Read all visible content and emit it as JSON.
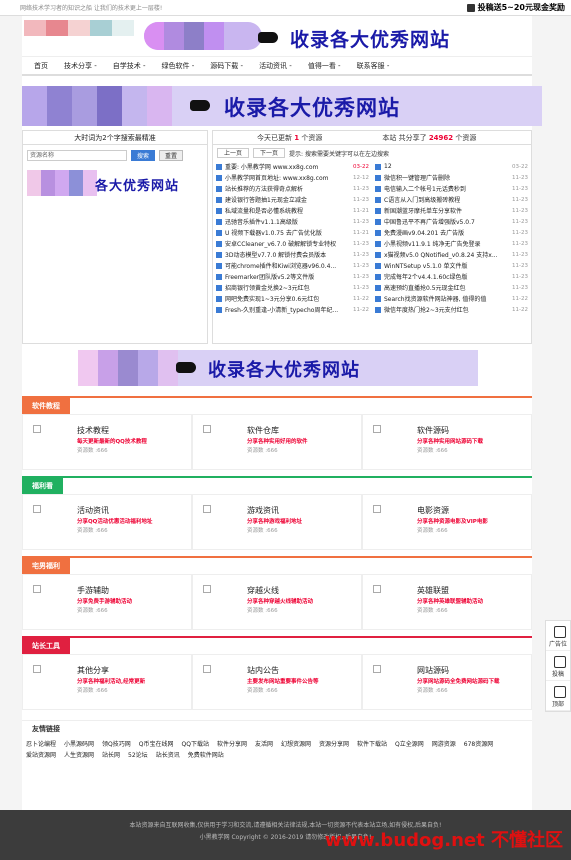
{
  "topbar": {
    "slogan": "网络技术学习者的知识之船 让我们的技术更上一层楼!",
    "submit": "投稿送5~20元现金奖励"
  },
  "banner_text": "收录各大优秀网站",
  "nav": [
    "首页",
    "技术分享 -",
    "自学技术 -",
    "绿色软件 -",
    "源码下载 -",
    "活动资讯 -",
    "值得一看 -",
    "联系客服 -"
  ],
  "left": {
    "head_prefix": "大时词为2个字搜索最精准",
    "search_placeholder": "资源名称",
    "search_btn": "搜索",
    "reset_btn": "重置",
    "logo_text": "各大优秀网站"
  },
  "right": {
    "head1_pre": "今天已更新",
    "head1_num": "1",
    "head1_post": "个资源",
    "head2_pre": "本站 共分享了",
    "head2_num": "24962",
    "head2_post": "个资源",
    "prev": "上一页",
    "next": "下一页",
    "tip": "提示: 搜索需要关键字可以在左边搜索",
    "list_left": [
      {
        "t": "重要: 小黑教学网 www.xx8g.com",
        "d": "03-22",
        "red": true
      },
      {
        "t": "小黑教学网首页地址: www.xx8g.com",
        "d": "12-12"
      },
      {
        "t": "站长推荐的方法获得奇点解析",
        "d": "11-23"
      },
      {
        "t": "建设银行答题抽1元现金立减金",
        "d": "11-23"
      },
      {
        "t": "私域流量和是否必懂系统教程",
        "d": "11-21"
      },
      {
        "t": "迅驰音乐插件v1.1.1高级版",
        "d": "11-23"
      },
      {
        "t": "U 视频下载器v1.0.75 去广告优化版",
        "d": "11-21"
      },
      {
        "t": "安卓CCleaner_v6.7.0 破解解锁专业特权",
        "d": "11-23"
      },
      {
        "t": "3D动态模型v7.7.0 解锁付费会员版本",
        "d": "11-23"
      },
      {
        "t": "可能chrome插件和Kiwi浏览器v96.0.4...",
        "d": "11-23"
      },
      {
        "t": "Freemarker团队版v5.2等文件版",
        "d": "11-23"
      },
      {
        "t": "招商银行领黄金兑换2~3元红包",
        "d": "11-23"
      },
      {
        "t": "网吧免费实现1~3元分享0.6元红包",
        "d": "11-22"
      },
      {
        "t": "Fresh-久别重逢-小清新_typecho周年纪...",
        "d": "11-22"
      }
    ],
    "list_right": [
      {
        "t": "12",
        "d": "03-22"
      },
      {
        "t": "微信积一键管理广告删除",
        "d": "11-23"
      },
      {
        "t": "电信输入二个帐号1元话费秒到",
        "d": "11-23"
      },
      {
        "t": "C语言从入门到高级搬砖教程",
        "d": "11-23"
      },
      {
        "t": "新国潮蓝牙摩托单车分享软件",
        "d": "11-23"
      },
      {
        "t": "中国鲁迅平不再广告增强版v5.0.7",
        "d": "11-23"
      },
      {
        "t": "免费漫画v9.04.201 去广告版",
        "d": "11-23"
      },
      {
        "t": "小黑视频v11.9.1 纯净无广告免登录",
        "d": "11-23"
      },
      {
        "t": "x猫视频v5.0 QNotified_v0.8.24 支持x...",
        "d": "11-23"
      },
      {
        "t": "WinNTSetup v5.1.0 单文件版",
        "d": "11-23"
      },
      {
        "t": "完成每年2个v4.4.1.60c绿色版",
        "d": "11-23"
      },
      {
        "t": "高速预约直播抢0.5元现金红包",
        "d": "11-23"
      },
      {
        "t": "Search找资源软件网站神器, 值得的值",
        "d": "11-22"
      },
      {
        "t": "微信年度热门抢2~3元支付红包",
        "d": "11-22"
      }
    ]
  },
  "sections": [
    {
      "tag": "软件教程",
      "color": "#f07040",
      "cards": [
        {
          "title": "技术教程",
          "desc": "每天更新最新的QQ技术教程",
          "count": "资源数 :666"
        },
        {
          "title": "软件仓库",
          "desc": "分享各种实用好用的软件",
          "count": "资源数 :666"
        },
        {
          "title": "软件源码",
          "desc": "分享各种实用网站源码下载",
          "count": "资源数 :666"
        }
      ]
    },
    {
      "tag": "福利看",
      "color": "#20b060",
      "cards": [
        {
          "title": "活动资讯",
          "desc": "分享QQ活动优惠活动福利地址",
          "count": "资源数 :666"
        },
        {
          "title": "游戏资讯",
          "desc": "分享各种游戏福利地址",
          "count": "资源数 :666"
        },
        {
          "title": "电影资源",
          "desc": "分享各种资源电影及VIP电影",
          "count": "资源数 :666"
        }
      ]
    },
    {
      "tag": "宅男福利",
      "color": "#f07040",
      "cards": [
        {
          "title": "手游辅助",
          "desc": "分享免费手游辅助活动",
          "count": "资源数 :666"
        },
        {
          "title": "穿越火线",
          "desc": "分享各种穿越火线辅助活动",
          "count": "资源数 :666"
        },
        {
          "title": "英雄联盟",
          "desc": "分享各种英雄联盟辅助活动",
          "count": "资源数 :666"
        }
      ]
    },
    {
      "tag": "站长工具",
      "color": "#e02040",
      "cards": [
        {
          "title": "其他分享",
          "desc": "分享各种福利活动,经常更新",
          "count": "资源数 :666"
        },
        {
          "title": "站内公告",
          "desc": "主要发布网站重要事件公告等",
          "count": "资源数 :666"
        },
        {
          "title": "网站源码",
          "desc": "分享网站源码全免费网站源码下载",
          "count": "资源数 :666"
        }
      ]
    }
  ],
  "friends": {
    "head": "友情链接",
    "links": [
      "忍卜论编程",
      "小黑源码网",
      "领Q技巧网",
      "Q币宝在线网",
      "QQ下载站",
      "软件分享网",
      "友活网",
      "幻想资源网",
      "资源分享网",
      "软件下载站",
      "Q立全源网",
      "网游资源",
      "678资源网",
      "爱站资源网",
      "人生资源网",
      "站长网",
      "52论坛",
      "站长资讯",
      "免费软件网站"
    ]
  },
  "footer": {
    "line1": "本站资源来自互联网收集,仅供用于学习和交流,请遵循相关法律法规,本站一切资源不代表本站立场,如有侵权,后果自负!",
    "line2": "小黑教学网 Copyright © 2016-2019 请勿修改版权, 后果自负!"
  },
  "watermark": "www.budog.net 不懂社区",
  "sidetools": [
    "广告位",
    "投稿",
    "顶部"
  ]
}
